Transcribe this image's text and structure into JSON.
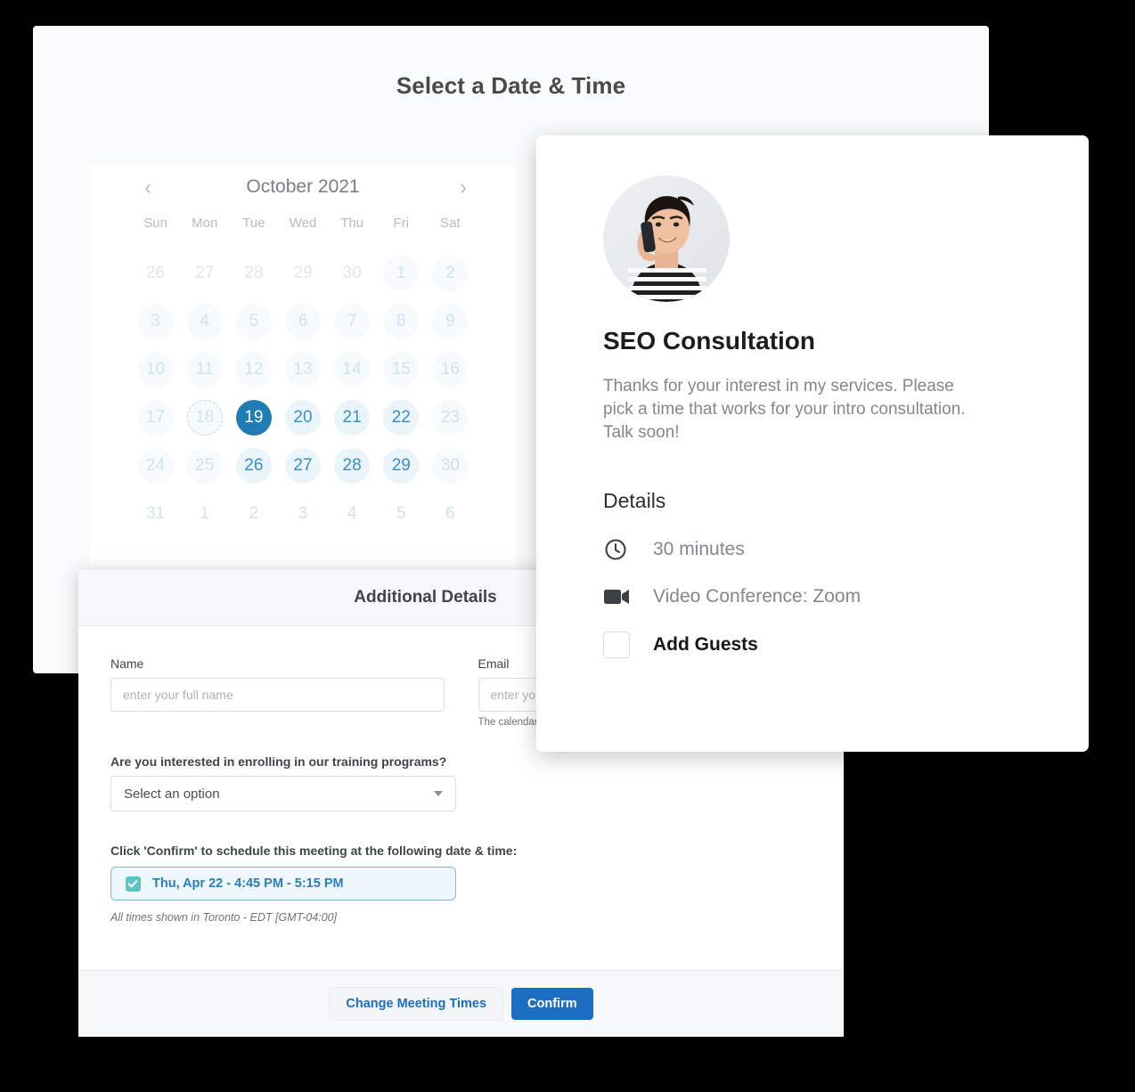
{
  "page": {
    "title": "Select a Date & Time"
  },
  "calendar": {
    "month_label": "October 2021",
    "prev_icon": "chevron-left-icon",
    "next_icon": "chevron-right-icon",
    "weekdays": [
      "Sun",
      "Mon",
      "Tue",
      "Wed",
      "Thu",
      "Fri",
      "Sat"
    ],
    "selected_day": "19",
    "today": "18",
    "weeks": [
      [
        {
          "n": "26",
          "state": "other"
        },
        {
          "n": "27",
          "state": "other"
        },
        {
          "n": "28",
          "state": "other"
        },
        {
          "n": "29",
          "state": "other"
        },
        {
          "n": "30",
          "state": "other"
        },
        {
          "n": "1",
          "state": "dim"
        },
        {
          "n": "2",
          "state": "dim"
        }
      ],
      [
        {
          "n": "3",
          "state": "dim"
        },
        {
          "n": "4",
          "state": "dim"
        },
        {
          "n": "5",
          "state": "dim"
        },
        {
          "n": "6",
          "state": "dim"
        },
        {
          "n": "7",
          "state": "dim"
        },
        {
          "n": "8",
          "state": "dim"
        },
        {
          "n": "9",
          "state": "dim"
        }
      ],
      [
        {
          "n": "10",
          "state": "dim"
        },
        {
          "n": "11",
          "state": "dim"
        },
        {
          "n": "12",
          "state": "dim"
        },
        {
          "n": "13",
          "state": "dim"
        },
        {
          "n": "14",
          "state": "dim"
        },
        {
          "n": "15",
          "state": "dim"
        },
        {
          "n": "16",
          "state": "dim"
        }
      ],
      [
        {
          "n": "17",
          "state": "dim"
        },
        {
          "n": "18",
          "state": "today"
        },
        {
          "n": "19",
          "state": "sel"
        },
        {
          "n": "20",
          "state": "avail"
        },
        {
          "n": "21",
          "state": "avail"
        },
        {
          "n": "22",
          "state": "avail"
        },
        {
          "n": "23",
          "state": "dim"
        }
      ],
      [
        {
          "n": "24",
          "state": "dim"
        },
        {
          "n": "25",
          "state": "dim"
        },
        {
          "n": "26",
          "state": "avail"
        },
        {
          "n": "27",
          "state": "avail"
        },
        {
          "n": "28",
          "state": "avail"
        },
        {
          "n": "29",
          "state": "avail"
        },
        {
          "n": "30",
          "state": "dim"
        }
      ],
      [
        {
          "n": "31",
          "state": "faded"
        },
        {
          "n": "1",
          "state": "faded"
        },
        {
          "n": "2",
          "state": "faded"
        },
        {
          "n": "3",
          "state": "faded"
        },
        {
          "n": "4",
          "state": "faded"
        },
        {
          "n": "5",
          "state": "faded"
        },
        {
          "n": "6",
          "state": "faded"
        }
      ]
    ]
  },
  "details_panel": {
    "header_title": "Additional Details",
    "name": {
      "label": "Name",
      "value": "",
      "placeholder": "enter your full name"
    },
    "email": {
      "label": "Email",
      "value": "",
      "placeholder": "enter you",
      "help": "The calendar i"
    },
    "question": {
      "label": "Are you interested in enrolling in our training programs?",
      "selected_option": "Select an option",
      "caret_icon": "chevron-down-icon"
    },
    "confirm_prompt": "Click 'Confirm' to schedule this meeting at the following date & time:",
    "selected_slot": {
      "text": "Thu, Apr 22 - 4:45 PM - 5:15 PM",
      "checked": true,
      "check_icon": "checkmark-icon"
    },
    "timezone_note": "All times shown in Toronto - EDT [GMT-04:00]",
    "footer": {
      "change_label": "Change Meeting Times",
      "confirm_label": "Confirm"
    }
  },
  "seo_card": {
    "avatar_name": "host-avatar-photo",
    "title": "SEO Consultation",
    "description": "Thanks for your interest in my services. Please pick a time that works for your intro consultation. Talk soon!",
    "details_heading": "Details",
    "rows": [
      {
        "icon": "clock-icon",
        "text": "30 minutes",
        "strong": false
      },
      {
        "icon": "video-camera-icon",
        "text": "Video Conference: Zoom",
        "strong": false
      },
      {
        "icon": "checkbox-empty-icon",
        "text": "Add Guests",
        "strong": true
      }
    ]
  },
  "colors": {
    "accent_blue": "#1f7cb4",
    "button_blue": "#1b6ec2",
    "slot_teal": "#5bc5c4",
    "slot_bg": "#eef7fc",
    "page_bg": "#fafbfc",
    "backdrop": "#000000"
  }
}
